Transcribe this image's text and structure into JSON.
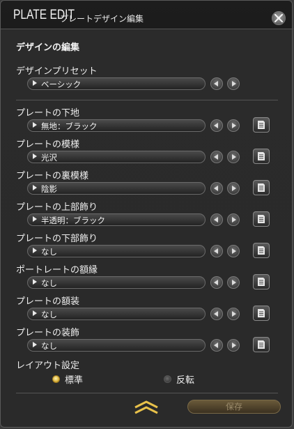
{
  "window": {
    "title_main": "PLATE EDIT",
    "title_sub": "プレートデザイン編集"
  },
  "section_heading": "デザインの編集",
  "preset": {
    "label": "デザインプリセット",
    "value": "ベーシック"
  },
  "rows": [
    {
      "label": "プレートの下地",
      "value": "無地：ブラック"
    },
    {
      "label": "プレートの模様",
      "value": "光沢"
    },
    {
      "label": "プレートの裏模様",
      "value": "陰影"
    },
    {
      "label": "プレートの上部飾り",
      "value": "半透明：ブラック"
    },
    {
      "label": "プレートの下部飾り",
      "value": "なし"
    },
    {
      "label": "ポートレートの額縁",
      "value": "なし"
    },
    {
      "label": "プレートの額装",
      "value": "なし"
    },
    {
      "label": "プレートの装飾",
      "value": "なし"
    }
  ],
  "layout": {
    "label": "レイアウト設定",
    "options": [
      {
        "label": "標準",
        "selected": true
      },
      {
        "label": "反転",
        "selected": false
      }
    ]
  },
  "footer": {
    "save_label": "保存"
  },
  "colors": {
    "accent_gold": "#d9b23a",
    "panel_bg": "#2a2a2a"
  }
}
